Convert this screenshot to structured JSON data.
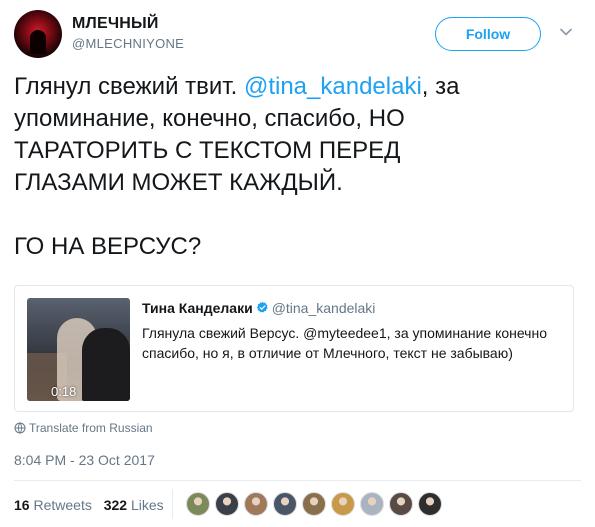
{
  "header": {
    "name": "МЛЕЧНЫЙ",
    "handle": "@MLECHNIYONE",
    "follow_label": "Follow"
  },
  "tweet": {
    "line1_pre": "Глянул свежий твит. ",
    "line1_mention": "@tina_kandelaki",
    "line1_post": ", за",
    "line2": "упоминание, конечно, спасибо, НО",
    "line3": "ТАРАТОРИТЬ С ТЕКСТОМ ПЕРЕД",
    "line4": "ГЛАЗАМИ МОЖЕТ КАЖДЫЙ.",
    "line5": "ГО НА ВЕРСУС?"
  },
  "quote": {
    "name": "Тина Канделаки",
    "handle": "@tina_kandelaki",
    "line1": "Глянула свежий Версус. @myteedee1, за упоминание конечно",
    "line2": "спасибо, но я, в отличие от Млечного, текст не забываю)",
    "duration": "0:18"
  },
  "translate_label": "Translate from Russian",
  "timestamp": "8:04 PM - 23 Oct 2017",
  "stats": {
    "retweets_count": "16",
    "retweets_label": "Retweets",
    "likes_count": "322",
    "likes_label": "Likes"
  },
  "colors": {
    "accent": "#1da1f2",
    "muted": "#657786",
    "text": "#14171a",
    "border": "#e1e8ed"
  },
  "likers": [
    {
      "icon": "liker-avatar",
      "color": "#7c8a5a"
    },
    {
      "icon": "liker-avatar",
      "color": "#3b3f4a"
    },
    {
      "icon": "liker-avatar",
      "color": "#a0785a"
    },
    {
      "icon": "liker-avatar",
      "color": "#4a5668"
    },
    {
      "icon": "liker-avatar",
      "color": "#8a6f4c"
    },
    {
      "icon": "liker-avatar",
      "color": "#c79a4a"
    },
    {
      "icon": "liker-avatar",
      "color": "#aab4c0"
    },
    {
      "icon": "liker-avatar",
      "color": "#5a4a44"
    },
    {
      "icon": "liker-avatar",
      "color": "#2e2e2e"
    }
  ]
}
